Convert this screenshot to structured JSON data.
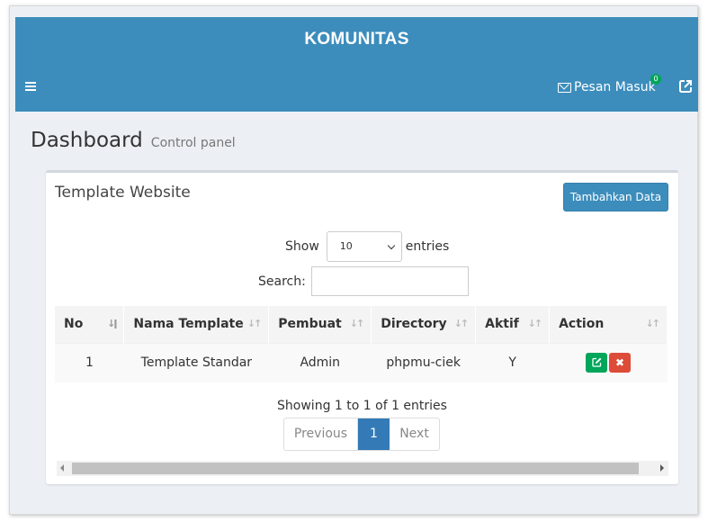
{
  "header": {
    "logo": "KOMUNITAS",
    "messages_label": "Pesan Masuk",
    "messages_count": "0"
  },
  "page": {
    "title": "Dashboard",
    "subtitle": "Control panel"
  },
  "box": {
    "title": "Template Website",
    "add_button": "Tambahkan Data",
    "show_label": "Show",
    "entries_value": "10",
    "entries_label": "entries",
    "search_label": "Search:",
    "search_value": ""
  },
  "table": {
    "columns": [
      "No",
      "Nama Template",
      "Pembuat",
      "Directory",
      "Aktif",
      "Action"
    ],
    "rows": [
      {
        "no": "1",
        "nama": "Template Standar",
        "pembuat": "Admin",
        "directory": "phpmu-ciek",
        "aktif": "Y"
      }
    ]
  },
  "footer": {
    "info": "Showing 1 to 1 of 1 entries",
    "prev": "Previous",
    "current": "1",
    "next": "Next"
  },
  "colors": {
    "primary": "#3c8dbc",
    "success": "#00a65a",
    "danger": "#dd4b39",
    "page_bg": "#ecf0f5"
  }
}
